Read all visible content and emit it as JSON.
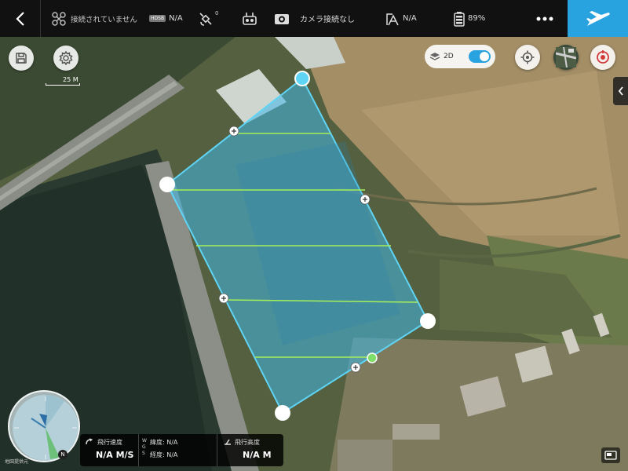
{
  "topbar": {
    "back_icon": "chevron-left-icon",
    "connection_status": "接続されていません",
    "hd_badge": "HDSB",
    "signal_value": "N/A",
    "satellite_count": "0",
    "remote_icon": "remote-controller-icon",
    "camera_status": "カメラ接続なし",
    "altitude_mode_value": "N/A",
    "battery_percent": "89%",
    "more_icon": "more-dots-icon",
    "fly_icon": "airplane-icon"
  },
  "map_controls": {
    "save_icon": "save-icon",
    "settings_icon": "gear-icon",
    "scale_label": "25 M",
    "view_mode_label": "2D",
    "view_mode_enabled": true,
    "locate_icon": "crosshair-icon",
    "map_type_icon": "map-thumbnail-icon",
    "record_icon": "record-icon",
    "side_tab_icon": "chevron-left-icon"
  },
  "mission": {
    "polygon_color": "#3fb8e8",
    "flight_line_color": "#a6f05a"
  },
  "telemetry": {
    "map_source": "地図提供元",
    "compass_north": "N",
    "speed_label": "飛行速度",
    "speed_value": "N/A M/S",
    "wgs_label": "W\nG\nS",
    "latitude_label": "緯度: N/A",
    "longitude_label": "経度: N/A",
    "altitude_label": "飛行高度",
    "altitude_value": "N/A M"
  }
}
